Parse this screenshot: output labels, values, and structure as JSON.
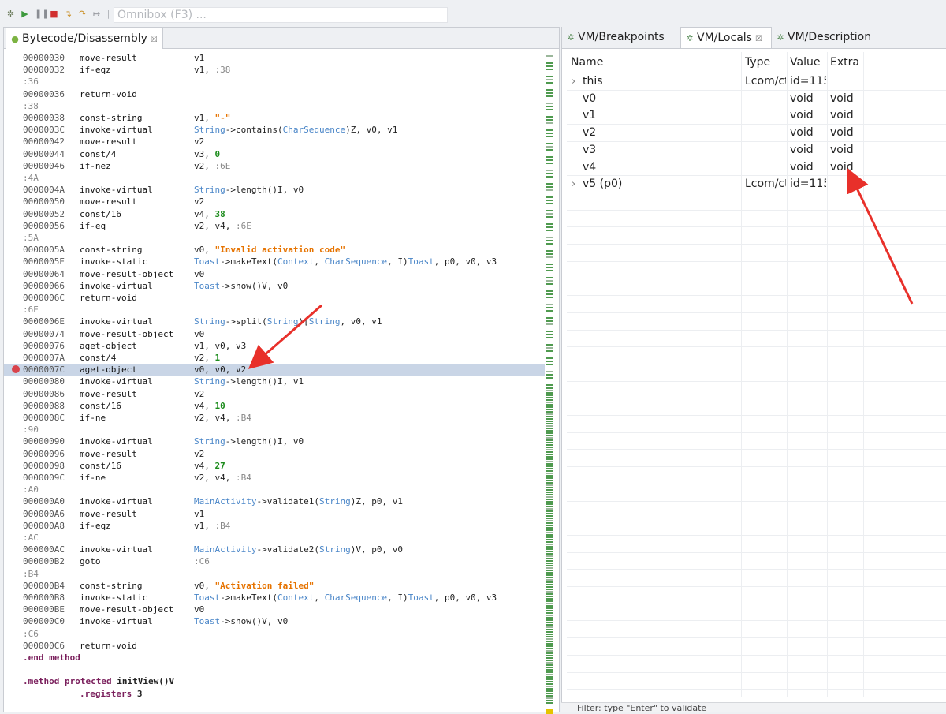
{
  "omnibox": {
    "placeholder": "Omnibox (F3) ..."
  },
  "toolbar_icons": [
    "gear-icon",
    "resume-icon",
    "pause-icon",
    "stop-icon",
    "step-into-icon",
    "step-over-icon",
    "step-return-icon"
  ],
  "left_tab": {
    "label": "Bytecode/Disassembly",
    "close": "☒"
  },
  "right_tabs": [
    {
      "label": "VM/Breakpoints"
    },
    {
      "label": "VM/Locals",
      "close": "☒"
    },
    {
      "label": "VM/Description"
    }
  ],
  "code_lines": [
    {
      "kind": "ins",
      "addr": "00000030",
      "op": "move-result",
      "args": [
        {
          "t": "v1",
          "c": "plain"
        }
      ]
    },
    {
      "kind": "ins",
      "addr": "00000032",
      "op": "if-eqz",
      "args": [
        {
          "t": "v1, ",
          "c": "plain"
        },
        {
          "t": ":38",
          "c": "lbl"
        }
      ]
    },
    {
      "kind": "label",
      "text": ":36"
    },
    {
      "kind": "ins",
      "addr": "00000036",
      "op": "return-void",
      "args": []
    },
    {
      "kind": "label",
      "text": ":38"
    },
    {
      "kind": "ins",
      "addr": "00000038",
      "op": "const-string",
      "args": [
        {
          "t": "v1, ",
          "c": "plain"
        },
        {
          "t": "\"-\"",
          "c": "str"
        }
      ]
    },
    {
      "kind": "ins",
      "addr": "0000003C",
      "op": "invoke-virtual",
      "args": [
        {
          "t": "String",
          "c": "ref"
        },
        {
          "t": "->contains(",
          "c": "plain"
        },
        {
          "t": "CharSequence",
          "c": "ref"
        },
        {
          "t": ")Z, v0, v1",
          "c": "plain"
        }
      ]
    },
    {
      "kind": "ins",
      "addr": "00000042",
      "op": "move-result",
      "args": [
        {
          "t": "v2",
          "c": "plain"
        }
      ]
    },
    {
      "kind": "ins",
      "addr": "00000044",
      "op": "const/4",
      "args": [
        {
          "t": "v3, ",
          "c": "plain"
        },
        {
          "t": "0",
          "c": "num"
        }
      ]
    },
    {
      "kind": "ins",
      "addr": "00000046",
      "op": "if-nez",
      "args": [
        {
          "t": "v2, ",
          "c": "plain"
        },
        {
          "t": ":6E",
          "c": "lbl"
        }
      ]
    },
    {
      "kind": "label",
      "text": ":4A"
    },
    {
      "kind": "ins",
      "addr": "0000004A",
      "op": "invoke-virtual",
      "args": [
        {
          "t": "String",
          "c": "ref"
        },
        {
          "t": "->length()I, v0",
          "c": "plain"
        }
      ]
    },
    {
      "kind": "ins",
      "addr": "00000050",
      "op": "move-result",
      "args": [
        {
          "t": "v2",
          "c": "plain"
        }
      ]
    },
    {
      "kind": "ins",
      "addr": "00000052",
      "op": "const/16",
      "args": [
        {
          "t": "v4, ",
          "c": "plain"
        },
        {
          "t": "38",
          "c": "num"
        }
      ]
    },
    {
      "kind": "ins",
      "addr": "00000056",
      "op": "if-eq",
      "args": [
        {
          "t": "v2, v4, ",
          "c": "plain"
        },
        {
          "t": ":6E",
          "c": "lbl"
        }
      ]
    },
    {
      "kind": "label",
      "text": ":5A"
    },
    {
      "kind": "ins",
      "addr": "0000005A",
      "op": "const-string",
      "args": [
        {
          "t": "v0, ",
          "c": "plain"
        },
        {
          "t": "\"Invalid activation code\"",
          "c": "str"
        }
      ]
    },
    {
      "kind": "ins",
      "addr": "0000005E",
      "op": "invoke-static",
      "args": [
        {
          "t": "Toast",
          "c": "ref"
        },
        {
          "t": "->makeText(",
          "c": "plain"
        },
        {
          "t": "Context",
          "c": "ref"
        },
        {
          "t": ", ",
          "c": "plain"
        },
        {
          "t": "CharSequence",
          "c": "ref"
        },
        {
          "t": ", I)",
          "c": "plain"
        },
        {
          "t": "Toast",
          "c": "ref"
        },
        {
          "t": ", p0, v0, v3",
          "c": "plain"
        }
      ]
    },
    {
      "kind": "ins",
      "addr": "00000064",
      "op": "move-result-object",
      "args": [
        {
          "t": "v0",
          "c": "plain"
        }
      ]
    },
    {
      "kind": "ins",
      "addr": "00000066",
      "op": "invoke-virtual",
      "args": [
        {
          "t": "Toast",
          "c": "ref"
        },
        {
          "t": "->show()V, v0",
          "c": "plain"
        }
      ]
    },
    {
      "kind": "ins",
      "addr": "0000006C",
      "op": "return-void",
      "args": []
    },
    {
      "kind": "label",
      "text": ":6E"
    },
    {
      "kind": "ins",
      "addr": "0000006E",
      "op": "invoke-virtual",
      "args": [
        {
          "t": "String",
          "c": "ref"
        },
        {
          "t": "->split(",
          "c": "plain"
        },
        {
          "t": "String",
          "c": "ref"
        },
        {
          "t": ")[",
          "c": "plain"
        },
        {
          "t": "String",
          "c": "ref"
        },
        {
          "t": ", v0, v1",
          "c": "plain"
        }
      ]
    },
    {
      "kind": "ins",
      "addr": "00000074",
      "op": "move-result-object",
      "args": [
        {
          "t": "v0",
          "c": "plain"
        }
      ]
    },
    {
      "kind": "ins",
      "addr": "00000076",
      "op": "aget-object",
      "args": [
        {
          "t": "v1, v0, v3",
          "c": "plain"
        }
      ]
    },
    {
      "kind": "ins",
      "addr": "0000007A",
      "op": "const/4",
      "args": [
        {
          "t": "v2, ",
          "c": "plain"
        },
        {
          "t": "1",
          "c": "num"
        }
      ]
    },
    {
      "kind": "ins",
      "addr": "0000007C",
      "op": "aget-object",
      "args": [
        {
          "t": "v0, v0, v2",
          "c": "plain"
        }
      ],
      "highlight": true,
      "breakpoint": true
    },
    {
      "kind": "ins",
      "addr": "00000080",
      "op": "invoke-virtual",
      "args": [
        {
          "t": "String",
          "c": "ref"
        },
        {
          "t": "->length()I, v1",
          "c": "plain"
        }
      ]
    },
    {
      "kind": "ins",
      "addr": "00000086",
      "op": "move-result",
      "args": [
        {
          "t": "v2",
          "c": "plain"
        }
      ]
    },
    {
      "kind": "ins",
      "addr": "00000088",
      "op": "const/16",
      "args": [
        {
          "t": "v4, ",
          "c": "plain"
        },
        {
          "t": "10",
          "c": "num"
        }
      ]
    },
    {
      "kind": "ins",
      "addr": "0000008C",
      "op": "if-ne",
      "args": [
        {
          "t": "v2, v4, ",
          "c": "plain"
        },
        {
          "t": ":B4",
          "c": "lbl"
        }
      ]
    },
    {
      "kind": "label",
      "text": ":90"
    },
    {
      "kind": "ins",
      "addr": "00000090",
      "op": "invoke-virtual",
      "args": [
        {
          "t": "String",
          "c": "ref"
        },
        {
          "t": "->length()I, v0",
          "c": "plain"
        }
      ]
    },
    {
      "kind": "ins",
      "addr": "00000096",
      "op": "move-result",
      "args": [
        {
          "t": "v2",
          "c": "plain"
        }
      ]
    },
    {
      "kind": "ins",
      "addr": "00000098",
      "op": "const/16",
      "args": [
        {
          "t": "v4, ",
          "c": "plain"
        },
        {
          "t": "27",
          "c": "num"
        }
      ]
    },
    {
      "kind": "ins",
      "addr": "0000009C",
      "op": "if-ne",
      "args": [
        {
          "t": "v2, v4, ",
          "c": "plain"
        },
        {
          "t": ":B4",
          "c": "lbl"
        }
      ]
    },
    {
      "kind": "label",
      "text": ":A0"
    },
    {
      "kind": "ins",
      "addr": "000000A0",
      "op": "invoke-virtual",
      "args": [
        {
          "t": "MainActivity",
          "c": "ref"
        },
        {
          "t": "->validate1(",
          "c": "plain"
        },
        {
          "t": "String",
          "c": "ref"
        },
        {
          "t": ")Z, p0, v1",
          "c": "plain"
        }
      ]
    },
    {
      "kind": "ins",
      "addr": "000000A6",
      "op": "move-result",
      "args": [
        {
          "t": "v1",
          "c": "plain"
        }
      ]
    },
    {
      "kind": "ins",
      "addr": "000000A8",
      "op": "if-eqz",
      "args": [
        {
          "t": "v1, ",
          "c": "plain"
        },
        {
          "t": ":B4",
          "c": "lbl"
        }
      ]
    },
    {
      "kind": "label",
      "text": ":AC"
    },
    {
      "kind": "ins",
      "addr": "000000AC",
      "op": "invoke-virtual",
      "args": [
        {
          "t": "MainActivity",
          "c": "ref"
        },
        {
          "t": "->validate2(",
          "c": "plain"
        },
        {
          "t": "String",
          "c": "ref"
        },
        {
          "t": ")V, p0, v0",
          "c": "plain"
        }
      ]
    },
    {
      "kind": "ins",
      "addr": "000000B2",
      "op": "goto",
      "args": [
        {
          "t": ":C6",
          "c": "lbl"
        }
      ]
    },
    {
      "kind": "label",
      "text": ":B4"
    },
    {
      "kind": "ins",
      "addr": "000000B4",
      "op": "const-string",
      "args": [
        {
          "t": "v0, ",
          "c": "plain"
        },
        {
          "t": "\"Activation failed\"",
          "c": "str"
        }
      ]
    },
    {
      "kind": "ins",
      "addr": "000000B8",
      "op": "invoke-static",
      "args": [
        {
          "t": "Toast",
          "c": "ref"
        },
        {
          "t": "->makeText(",
          "c": "plain"
        },
        {
          "t": "Context",
          "c": "ref"
        },
        {
          "t": ", ",
          "c": "plain"
        },
        {
          "t": "CharSequence",
          "c": "ref"
        },
        {
          "t": ", I)",
          "c": "plain"
        },
        {
          "t": "Toast",
          "c": "ref"
        },
        {
          "t": ", p0, v0, v3",
          "c": "plain"
        }
      ]
    },
    {
      "kind": "ins",
      "addr": "000000BE",
      "op": "move-result-object",
      "args": [
        {
          "t": "v0",
          "c": "plain"
        }
      ]
    },
    {
      "kind": "ins",
      "addr": "000000C0",
      "op": "invoke-virtual",
      "args": [
        {
          "t": "Toast",
          "c": "ref"
        },
        {
          "t": "->show()V, v0",
          "c": "plain"
        }
      ]
    },
    {
      "kind": "label",
      "text": ":C6"
    },
    {
      "kind": "ins",
      "addr": "000000C6",
      "op": "return-void",
      "args": []
    },
    {
      "kind": "directive",
      "parts": [
        {
          "t": ".end method",
          "c": "kw"
        }
      ]
    },
    {
      "kind": "blank"
    },
    {
      "kind": "directive",
      "parts": [
        {
          "t": ".method protected ",
          "c": "kw"
        },
        {
          "t": "initView()V",
          "c": "plain"
        }
      ]
    },
    {
      "kind": "directive2",
      "parts": [
        {
          "t": ".registers ",
          "c": "kw"
        },
        {
          "t": "3",
          "c": "plain"
        }
      ]
    }
  ],
  "locals": {
    "columns": [
      "Name",
      "Type",
      "Value",
      "Extra"
    ],
    "rows": [
      {
        "name": "this",
        "type": "Lcom/ct",
        "value": "id=115",
        "extra": "",
        "expandable": true
      },
      {
        "name": "v0",
        "type": "",
        "value": "void",
        "extra": "void",
        "expandable": false
      },
      {
        "name": "v1",
        "type": "",
        "value": "void",
        "extra": "void",
        "expandable": false
      },
      {
        "name": "v2",
        "type": "",
        "value": "void",
        "extra": "void",
        "expandable": false
      },
      {
        "name": "v3",
        "type": "",
        "value": "void",
        "extra": "void",
        "expandable": false
      },
      {
        "name": "v4",
        "type": "",
        "value": "void",
        "extra": "void",
        "expandable": false
      },
      {
        "name": "v5 (p0)",
        "type": "Lcom/ct",
        "value": "id=115",
        "extra": "",
        "expandable": true
      }
    ],
    "filter_text": "Filter: type \"Enter\" to validate"
  },
  "colors": {
    "accent_ref": "#4a86c8",
    "string": "#e67300",
    "number": "#1c8c1c",
    "highlight": "#c9d5e6",
    "breakpoint": "#d9434b",
    "annotation_arrow": "#e8302a"
  }
}
